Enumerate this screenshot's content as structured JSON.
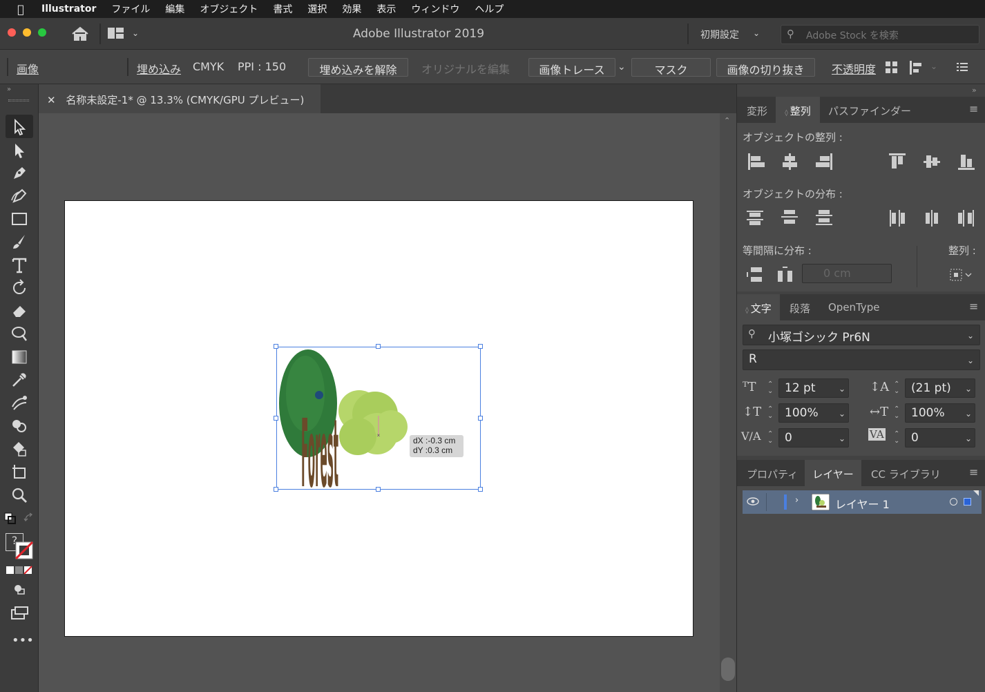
{
  "menubar": {
    "app_name": "Illustrator",
    "items": [
      "ファイル",
      "編集",
      "オブジェクト",
      "書式",
      "選択",
      "効果",
      "表示",
      "ウィンドウ",
      "ヘルプ"
    ]
  },
  "titlebar": {
    "title": "Adobe Illustrator 2019",
    "workspace": "初期設定",
    "search_placeholder": "Adobe Stock を検索"
  },
  "control_bar": {
    "object_type": "画像",
    "embed_label": "埋め込み",
    "color_mode": "CMYK",
    "ppi": "PPI : 150",
    "unembed_button": "埋め込みを解除",
    "edit_original_button": "オリジナルを編集",
    "image_trace_button": "画像トレース",
    "mask_button": "マスク",
    "crop_button": "画像の切り抜き",
    "opacity_label": "不透明度"
  },
  "document_tab": {
    "label": "名称未設定-1* @ 13.3% (CMYK/GPU プレビュー)"
  },
  "canvas": {
    "tooltip_dx": "dX :-0.3 cm",
    "tooltip_dy": "dY :0.3 cm",
    "art_word": "Forest"
  },
  "align_panel": {
    "tabs": [
      "変形",
      "整列",
      "パスファインダー"
    ],
    "active_tab": "整列",
    "align_objects_label": "オブジェクトの整列 :",
    "distribute_objects_label": "オブジェクトの分布 :",
    "distribute_spacing_label": "等間隔に分布 :",
    "align_to_label": "整列 :",
    "spacing_value": "0 cm"
  },
  "character_panel": {
    "tabs": [
      "文字",
      "段落",
      "OpenType"
    ],
    "active_tab": "文字",
    "font_family": "小塚ゴシック Pr6N",
    "font_style": "R",
    "font_size": "12 pt",
    "leading": "(21 pt)",
    "vertical_scale": "100%",
    "horizontal_scale": "100%",
    "kerning": "0",
    "tracking": "0"
  },
  "layers_panel": {
    "tabs": [
      "プロパティ",
      "レイヤー",
      "CC ライブラリ"
    ],
    "active_tab": "レイヤー",
    "layers": [
      {
        "name": "レイヤー 1",
        "color": "#4a7fe0"
      }
    ]
  },
  "colors": {
    "selection": "#4a7fe0",
    "tree_dark": "#2f7a3a",
    "tree_light": "#b6d66a",
    "letters": "#6b4a2a"
  }
}
